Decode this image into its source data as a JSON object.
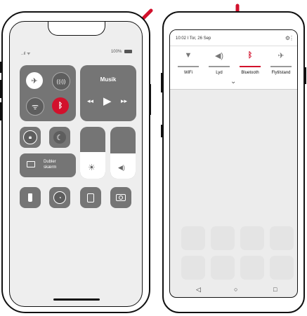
{
  "iphone": {
    "status_signal": "..ıl ᯤ",
    "battery_percent": "100%",
    "media_title": "Musik",
    "screen_mirroring_line1": "Dubler",
    "screen_mirroring_line2": "skærm",
    "icons": {
      "airplane": "airplane-icon",
      "cellular": "cellular-icon",
      "wifi": "wifi-icon",
      "bluetooth": "bluetooth-icon",
      "rotation_lock": "rotation-lock-icon",
      "do_not_disturb": "moon-icon",
      "brightness": "brightness-icon",
      "volume": "volume-icon",
      "flashlight": "flashlight-icon",
      "timer": "timer-icon",
      "calculator": "calculator-icon",
      "camera": "camera-icon"
    }
  },
  "android": {
    "status_text": "10:02 I Tor, 26 Sep",
    "quick_settings": [
      {
        "label": "WiFi",
        "icon": "wifi-icon",
        "active": false
      },
      {
        "label": "Lyd",
        "icon": "sound-icon",
        "active": false
      },
      {
        "label": "Bluetooth",
        "icon": "bluetooth-icon",
        "active": true
      },
      {
        "label": "Flytilstand",
        "icon": "airplane-icon",
        "active": false
      }
    ]
  },
  "colors": {
    "accent": "#d2112c",
    "tile": "#757575",
    "screen_bg": "#eeeeee"
  }
}
